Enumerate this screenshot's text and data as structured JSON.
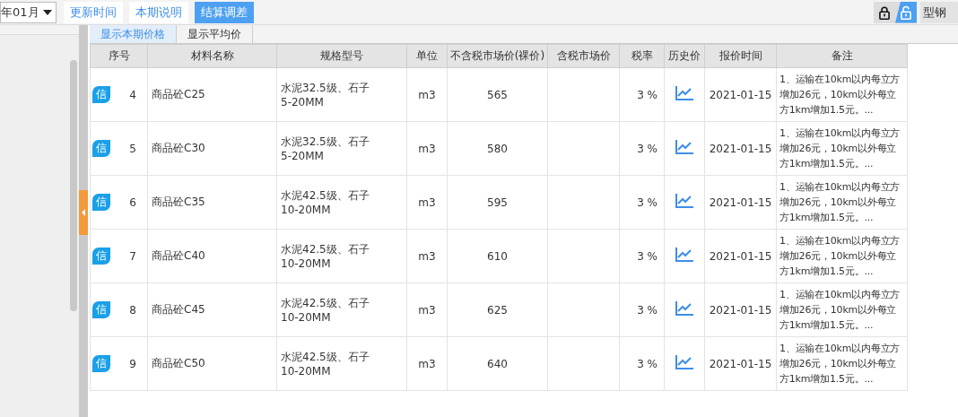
{
  "toolbar": {
    "period_select": {
      "value": "年01月"
    },
    "buttons": [
      {
        "label": "更新时间",
        "selected": false
      },
      {
        "label": "本期说明",
        "selected": false
      },
      {
        "label": "结算调差",
        "selected": true
      }
    ],
    "lock_toggle": [
      {
        "kind": "locked",
        "selected": false
      },
      {
        "kind": "unlocked",
        "selected": true
      }
    ],
    "category": "型钢"
  },
  "price_tabs": [
    {
      "label": "显示本期价格",
      "selected": true
    },
    {
      "label": "显示平均价",
      "selected": false
    }
  ],
  "table": {
    "columns": [
      "序号",
      "材料名称",
      "规格型号",
      "单位",
      "不含税市场价(裸价)",
      "含税市场价",
      "税率",
      "历史价",
      "报价时间",
      "备注"
    ],
    "rows": [
      {
        "badge": "信",
        "no": "4",
        "name": "商品砼C25",
        "spec": "水泥32.5级、石子5-20MM",
        "unit": "m3",
        "price_ex_tax": "565",
        "tax_rate": "3 %",
        "date": "2021-01-15",
        "remark": "1、运输在10km以内每立方增加26元，10km以外每立方1km增加1.5元。..."
      },
      {
        "badge": "信",
        "no": "5",
        "name": "商品砼C30",
        "spec": "水泥32.5级、石子5-20MM",
        "unit": "m3",
        "price_ex_tax": "580",
        "tax_rate": "3 %",
        "date": "2021-01-15",
        "remark": "1、运输在10km以内每立方增加26元，10km以外每立方1km增加1.5元。..."
      },
      {
        "badge": "信",
        "no": "6",
        "name": "商品砼C35",
        "spec": "水泥42.5级、石子10-20MM",
        "unit": "m3",
        "price_ex_tax": "595",
        "tax_rate": "3 %",
        "date": "2021-01-15",
        "remark": "1、运输在10km以内每立方增加26元，10km以外每立方1km增加1.5元。..."
      },
      {
        "badge": "信",
        "no": "7",
        "name": "商品砼C40",
        "spec": "水泥42.5级、石子10-20MM",
        "unit": "m3",
        "price_ex_tax": "610",
        "tax_rate": "3 %",
        "date": "2021-01-15",
        "remark": "1、运输在10km以内每立方增加26元，10km以外每立方1km增加1.5元。..."
      },
      {
        "badge": "信",
        "no": "8",
        "name": "商品砼C45",
        "spec": "水泥42.5级、石子10-20MM",
        "unit": "m3",
        "price_ex_tax": "625",
        "tax_rate": "3 %",
        "date": "2021-01-15",
        "remark": "1、运输在10km以内每立方增加26元，10km以外每立方1km增加1.5元。..."
      },
      {
        "badge": "信",
        "no": "9",
        "name": "商品砼C50",
        "spec": "水泥42.5级、石子10-20MM",
        "unit": "m3",
        "price_ex_tax": "640",
        "tax_rate": "3 %",
        "date": "2021-01-15",
        "remark": "1、运输在10km以内每立方增加26元，10km以外每立方1km增加1.5元。..."
      }
    ]
  }
}
